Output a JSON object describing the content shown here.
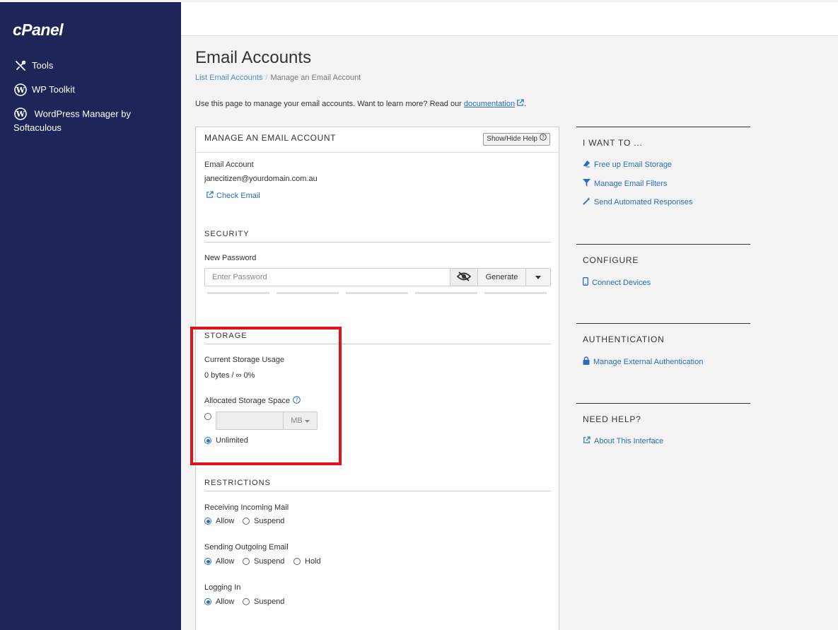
{
  "sidebar": {
    "logo": "cPanel",
    "items": [
      {
        "label": "Tools",
        "icon": "tools-icon"
      },
      {
        "label": "WP Toolkit",
        "icon": "wordpress-icon"
      },
      {
        "label": "WordPress Manager by Softaculous",
        "icon": "wordpress-icon"
      }
    ]
  },
  "page": {
    "title": "Email Accounts",
    "breadcrumb": {
      "link": "List Email Accounts",
      "current": "Manage an Email Account"
    },
    "intro_text": "Use this page to manage your email accounts. Want to learn more? Read our",
    "intro_link": "documentation",
    "intro_end": "."
  },
  "panel": {
    "heading": "MANAGE AN EMAIL ACCOUNT",
    "help_button": "Show/Hide Help",
    "email_label": "Email Account",
    "email_value": "janecitizen@yourdomain.com.au",
    "check_email": "Check Email",
    "security": {
      "title": "SECURITY",
      "new_password_label": "New Password",
      "password_placeholder": "Enter Password",
      "generate_label": "Generate"
    },
    "storage": {
      "title": "STORAGE",
      "usage_label": "Current Storage Usage",
      "usage_value": "0 bytes / ∞ 0%",
      "allocated_label": "Allocated Storage Space",
      "unit": "MB",
      "unlimited_label": "Unlimited",
      "selected": "unlimited"
    },
    "restrictions": {
      "title": "RESTRICTIONS",
      "incoming_label": "Receiving Incoming Mail",
      "incoming_options": [
        "Allow",
        "Suspend"
      ],
      "outgoing_label": "Sending Outgoing Email",
      "outgoing_options": [
        "Allow",
        "Suspend",
        "Hold"
      ],
      "login_label": "Logging In",
      "login_options": [
        "Allow",
        "Suspend"
      ],
      "selected": "Allow"
    }
  },
  "right": {
    "i_want_to": {
      "title": "I WANT TO ...",
      "links": [
        "Free up Email Storage",
        "Manage Email Filters",
        "Send Automated Responses"
      ]
    },
    "configure": {
      "title": "CONFIGURE",
      "links": [
        "Connect Devices"
      ]
    },
    "authentication": {
      "title": "AUTHENTICATION",
      "links": [
        "Manage External Authentication"
      ]
    },
    "need_help": {
      "title": "NEED HELP?",
      "links": [
        "About This Interface"
      ]
    }
  },
  "colors": {
    "sidebar_bg": "#1f2559",
    "link": "#2a6ebb",
    "highlight_border": "#e0121a",
    "radio_selected": "#2a6ebb"
  }
}
